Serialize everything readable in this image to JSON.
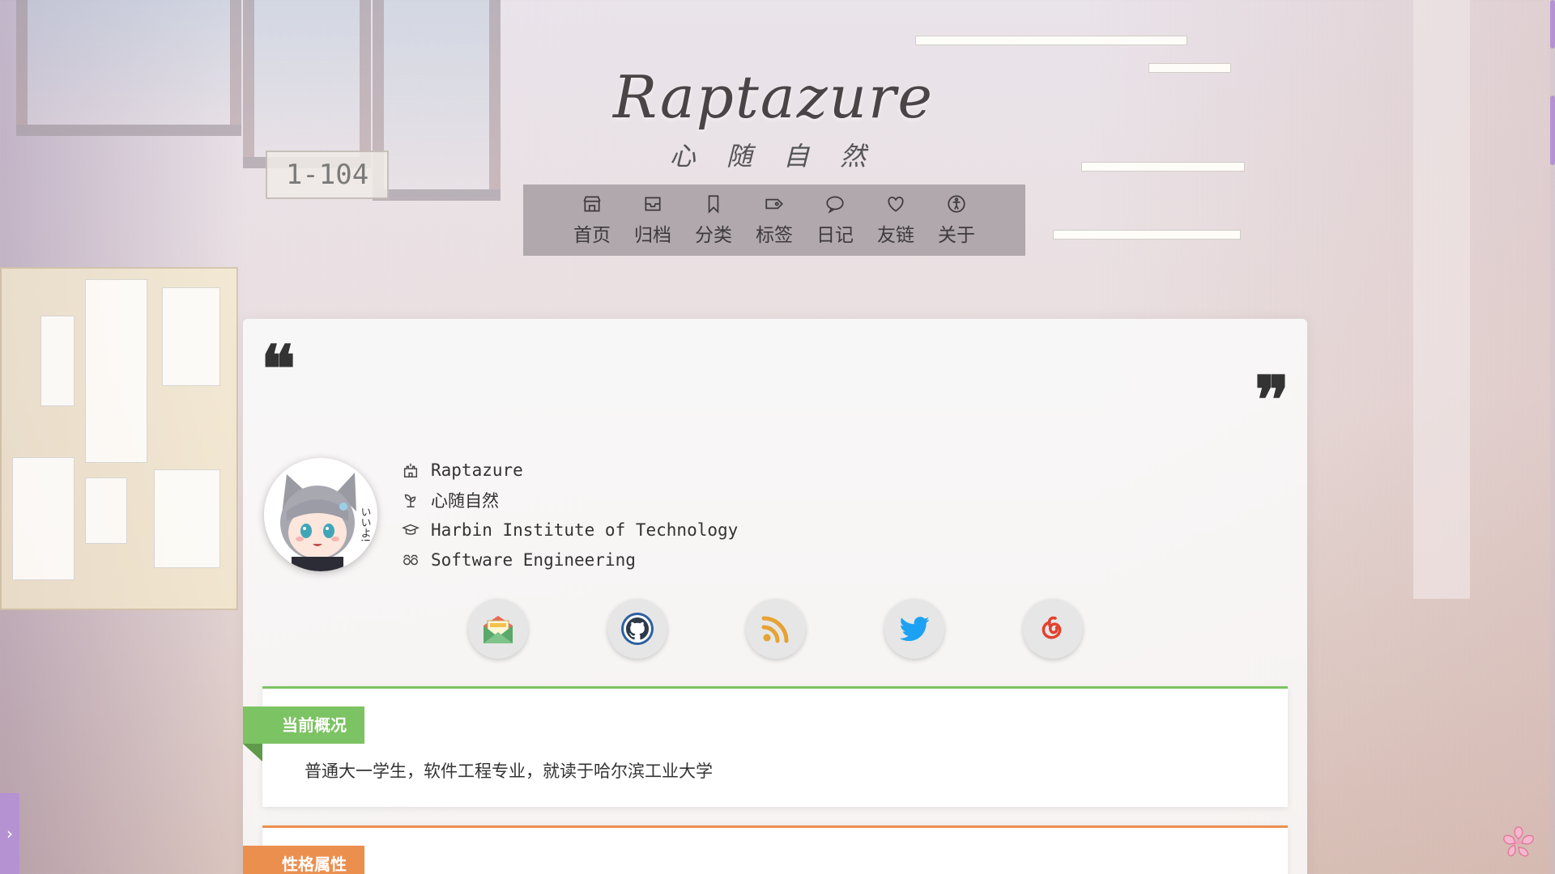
{
  "site": {
    "title": "Raptazure",
    "subtitle": "心 随 自 然"
  },
  "nav": {
    "items": [
      {
        "label": "首页",
        "icon": "home-icon"
      },
      {
        "label": "归档",
        "icon": "archive-icon"
      },
      {
        "label": "分类",
        "icon": "bookmark-icon"
      },
      {
        "label": "标签",
        "icon": "tag-icon"
      },
      {
        "label": "日记",
        "icon": "chat-bubble-icon"
      },
      {
        "label": "友链",
        "icon": "heart-icon"
      },
      {
        "label": "关于",
        "icon": "accessibility-icon"
      }
    ]
  },
  "profile": {
    "name": "Raptazure",
    "motto": "心随自然",
    "school": "Harbin Institute of Technology",
    "major": "Software Engineering",
    "avatar_text": "いいよ!"
  },
  "social": [
    {
      "name": "email",
      "icon": "email-invoice-icon"
    },
    {
      "name": "github",
      "icon": "github-icon"
    },
    {
      "name": "rss",
      "icon": "rss-icon"
    },
    {
      "name": "twitter",
      "icon": "twitter-icon"
    },
    {
      "name": "netease-music",
      "icon": "netease-music-icon"
    }
  ],
  "sections": [
    {
      "tag": "当前概况",
      "text": "普通大一学生，软件工程专业，就读于哈尔滨工业大学",
      "color": "#7cc363"
    },
    {
      "tag": "性格属性",
      "text": "",
      "color": "#eb8f4f"
    }
  ],
  "background": {
    "room_sign": "1-104"
  },
  "colors": {
    "accent": "#b593d3",
    "green": "#7cc363",
    "orange": "#eb8f4f"
  }
}
